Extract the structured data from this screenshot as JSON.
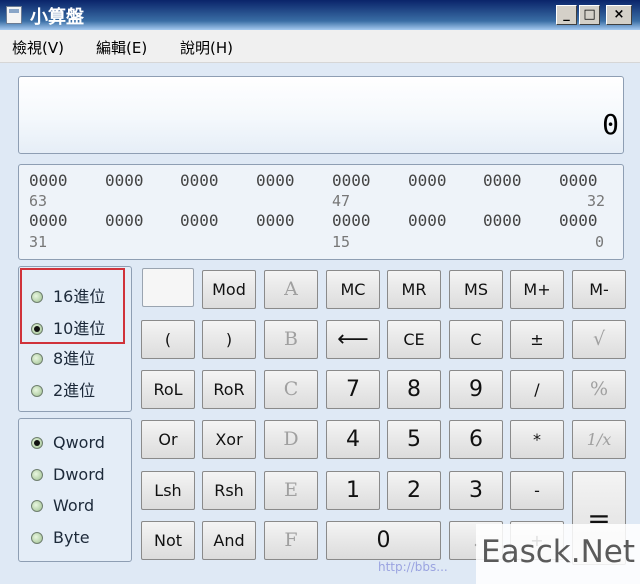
{
  "window": {
    "title": "小算盤",
    "min_label": "_",
    "max_label": "□",
    "close_label": "×"
  },
  "menu": [
    {
      "label": "檢視(V)"
    },
    {
      "label": "編輯(E)"
    },
    {
      "label": "說明(H)"
    }
  ],
  "display": {
    "value": "0"
  },
  "bits": {
    "row1": [
      "0000",
      "0000",
      "0000",
      "0000",
      "0000",
      "0000",
      "0000",
      "0000"
    ],
    "row1_marks": [
      "63",
      "47",
      "32"
    ],
    "row2": [
      "0000",
      "0000",
      "0000",
      "0000",
      "0000",
      "0000",
      "0000",
      "0000"
    ],
    "row2_marks": [
      "31",
      "15",
      "0"
    ]
  },
  "base": [
    {
      "label": "16進位",
      "selected": false
    },
    {
      "label": "10進位",
      "selected": true
    },
    {
      "label": "8進位",
      "selected": false
    },
    {
      "label": "2進位",
      "selected": false
    }
  ],
  "word_size": [
    {
      "label": "Qword",
      "selected": true
    },
    {
      "label": "Dword",
      "selected": false
    },
    {
      "label": "Word",
      "selected": false
    },
    {
      "label": "Byte",
      "selected": false
    }
  ],
  "keys": {
    "mod": "Mod",
    "a": "A",
    "mc": "MC",
    "mr": "MR",
    "ms": "MS",
    "mplus": "M+",
    "mminus": "M-",
    "lparen": "(",
    "rparen": ")",
    "b": "B",
    "back": "⟵",
    "ce": "CE",
    "c": "C",
    "pm": "±",
    "sqrt": "√",
    "rol": "RoL",
    "ror": "RoR",
    "hc": "C",
    "n7": "7",
    "n8": "8",
    "n9": "9",
    "div": "/",
    "pct": "%",
    "or": "Or",
    "xor": "Xor",
    "d": "D",
    "n4": "4",
    "n5": "5",
    "n6": "6",
    "mul": "*",
    "recip": "1/x",
    "lsh": "Lsh",
    "rsh": "Rsh",
    "e": "E",
    "n1": "1",
    "n2": "2",
    "n3": "3",
    "sub": "-",
    "eq": "=",
    "not": "Not",
    "and": "And",
    "f": "F",
    "n0": "0",
    "dot": ".",
    "add": "+"
  },
  "watermark": "Easck.Net",
  "watermark_sub": "http://bbs..."
}
